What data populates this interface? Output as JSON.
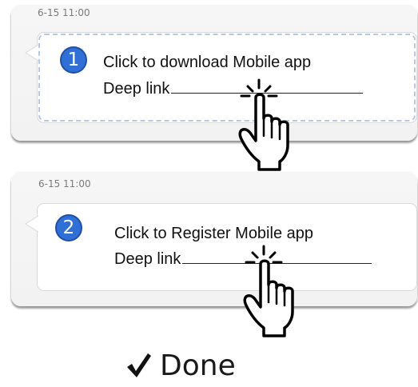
{
  "steps": [
    {
      "timestamp": "6-15 11:00",
      "number": "1",
      "line1": "Click to download Mobile app",
      "line2": "Deep link"
    },
    {
      "timestamp": "6-15 11:00",
      "number": "2",
      "line1": "Click to Register Mobile app",
      "line2": "Deep link"
    }
  ],
  "done": {
    "label": "Done",
    "icon": "checkmark-icon"
  },
  "icons": {
    "hand": "pointing-hand-click-icon"
  },
  "colors": {
    "number_badge": "#2f6fd6",
    "dashed_border": "#b6c9e4",
    "card_background": "#f4f4f4"
  }
}
